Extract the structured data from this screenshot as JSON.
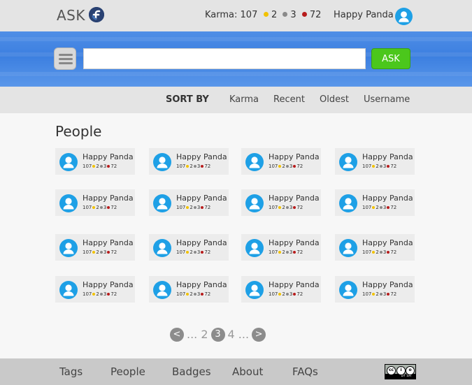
{
  "header": {
    "logo_text": "ASK",
    "karma_label": "Karma: 107",
    "badges": {
      "gold": "2",
      "silver": "3",
      "bronze": "72"
    },
    "username": "Happy Panda"
  },
  "search": {
    "placeholder": "",
    "ask_label": "ASK"
  },
  "sort": {
    "label": "SORT BY",
    "options": [
      "Karma",
      "Recent",
      "Oldest",
      "Username"
    ]
  },
  "main": {
    "title": "People",
    "users": [
      {
        "name": "Happy Panda",
        "karma": "107",
        "gold": "2",
        "silver": "3",
        "bronze": "72"
      },
      {
        "name": "Happy Panda",
        "karma": "107",
        "gold": "2",
        "silver": "3",
        "bronze": "72"
      },
      {
        "name": "Happy Panda",
        "karma": "107",
        "gold": "2",
        "silver": "3",
        "bronze": "72"
      },
      {
        "name": "Happy Panda",
        "karma": "107",
        "gold": "2",
        "silver": "3",
        "bronze": "72"
      },
      {
        "name": "Happy Panda",
        "karma": "107",
        "gold": "2",
        "silver": "3",
        "bronze": "72"
      },
      {
        "name": "Happy Panda",
        "karma": "107",
        "gold": "2",
        "silver": "3",
        "bronze": "72"
      },
      {
        "name": "Happy Panda",
        "karma": "107",
        "gold": "2",
        "silver": "3",
        "bronze": "72"
      },
      {
        "name": "Happy Panda",
        "karma": "107",
        "gold": "2",
        "silver": "3",
        "bronze": "72"
      },
      {
        "name": "Happy Panda",
        "karma": "107",
        "gold": "2",
        "silver": "3",
        "bronze": "72"
      },
      {
        "name": "Happy Panda",
        "karma": "107",
        "gold": "2",
        "silver": "3",
        "bronze": "72"
      },
      {
        "name": "Happy Panda",
        "karma": "107",
        "gold": "2",
        "silver": "3",
        "bronze": "72"
      },
      {
        "name": "Happy Panda",
        "karma": "107",
        "gold": "2",
        "silver": "3",
        "bronze": "72"
      },
      {
        "name": "Happy Panda",
        "karma": "107",
        "gold": "2",
        "silver": "3",
        "bronze": "72"
      },
      {
        "name": "Happy Panda",
        "karma": "107",
        "gold": "2",
        "silver": "3",
        "bronze": "72"
      },
      {
        "name": "Happy Panda",
        "karma": "107",
        "gold": "2",
        "silver": "3",
        "bronze": "72"
      },
      {
        "name": "Happy Panda",
        "karma": "107",
        "gold": "2",
        "silver": "3",
        "bronze": "72"
      }
    ]
  },
  "pagination": {
    "prev": "<",
    "ellipsis_left": "... 2",
    "current": "3",
    "ellipsis_right": "4 ...",
    "next": ">"
  },
  "footer": {
    "links": [
      "Tags",
      "People",
      "Badges",
      "About",
      "FAQs"
    ],
    "license_text": "BY SA"
  },
  "colors": {
    "accent_blue": "#3c7fe0",
    "ask_green": "#4bc71c",
    "avatar_blue": "#1ea0e6",
    "gold": "#f2c200",
    "silver": "#8a8a8a",
    "bronze": "#b71c1c"
  },
  "icons": {
    "logo": "fedora-logo-icon",
    "menu": "hamburger-menu-icon",
    "avatar": "user-avatar-icon",
    "license": "creative-commons-by-sa-icon"
  }
}
